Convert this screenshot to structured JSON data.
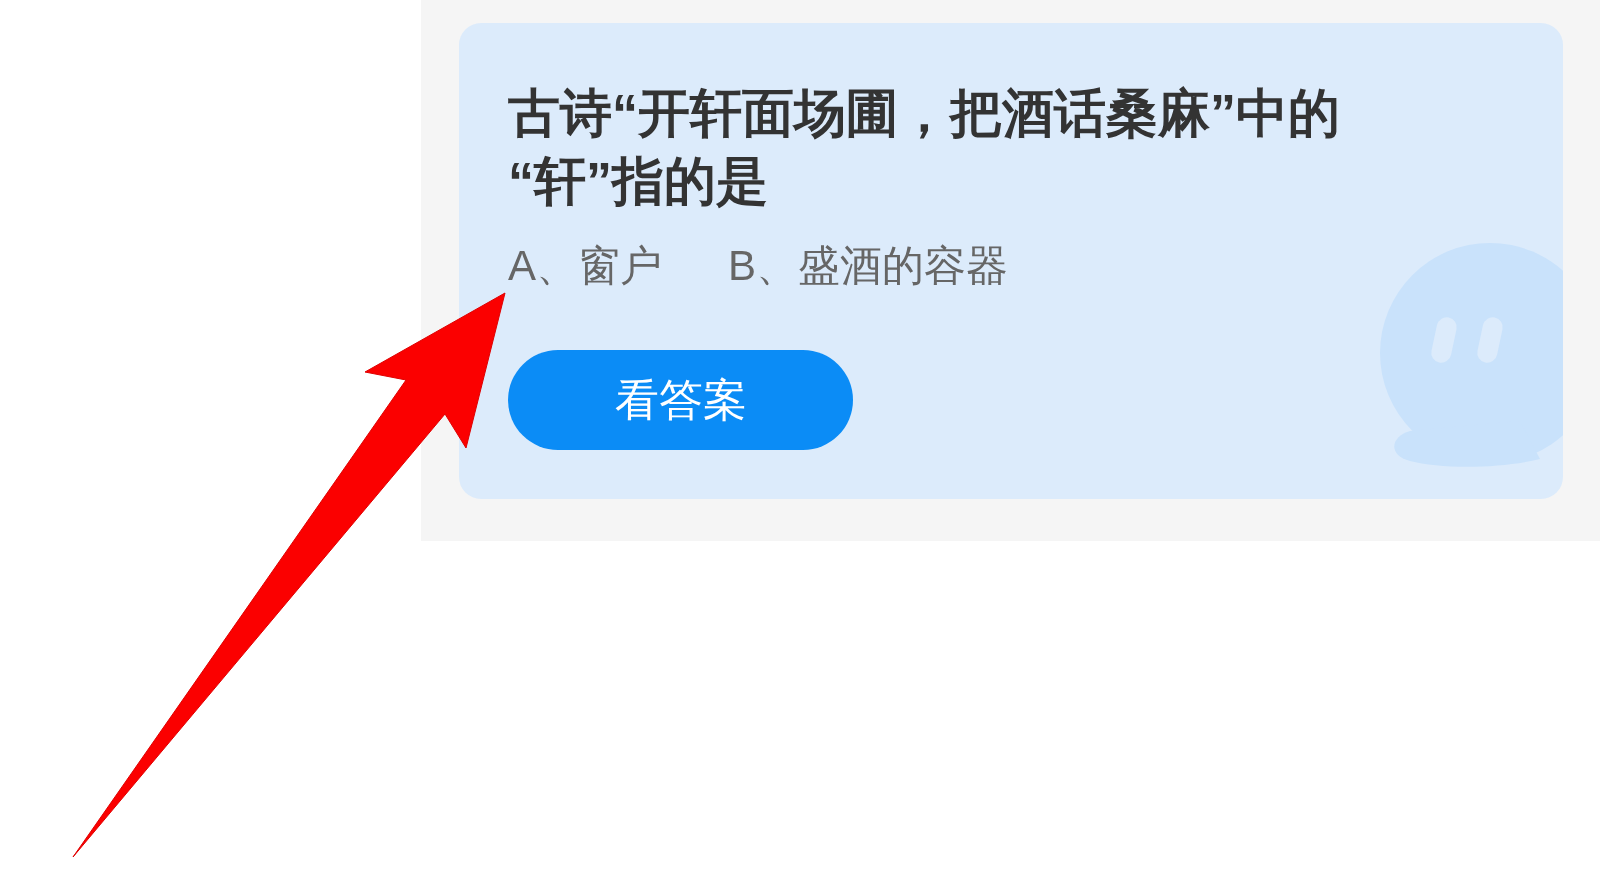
{
  "quiz_card": {
    "question": "古诗“开轩面场圃，把酒话桑麻”中的“轩”指的是",
    "options": [
      "A、窗户",
      "B、盛酒的容器"
    ],
    "button": {
      "label": "看答案"
    }
  }
}
